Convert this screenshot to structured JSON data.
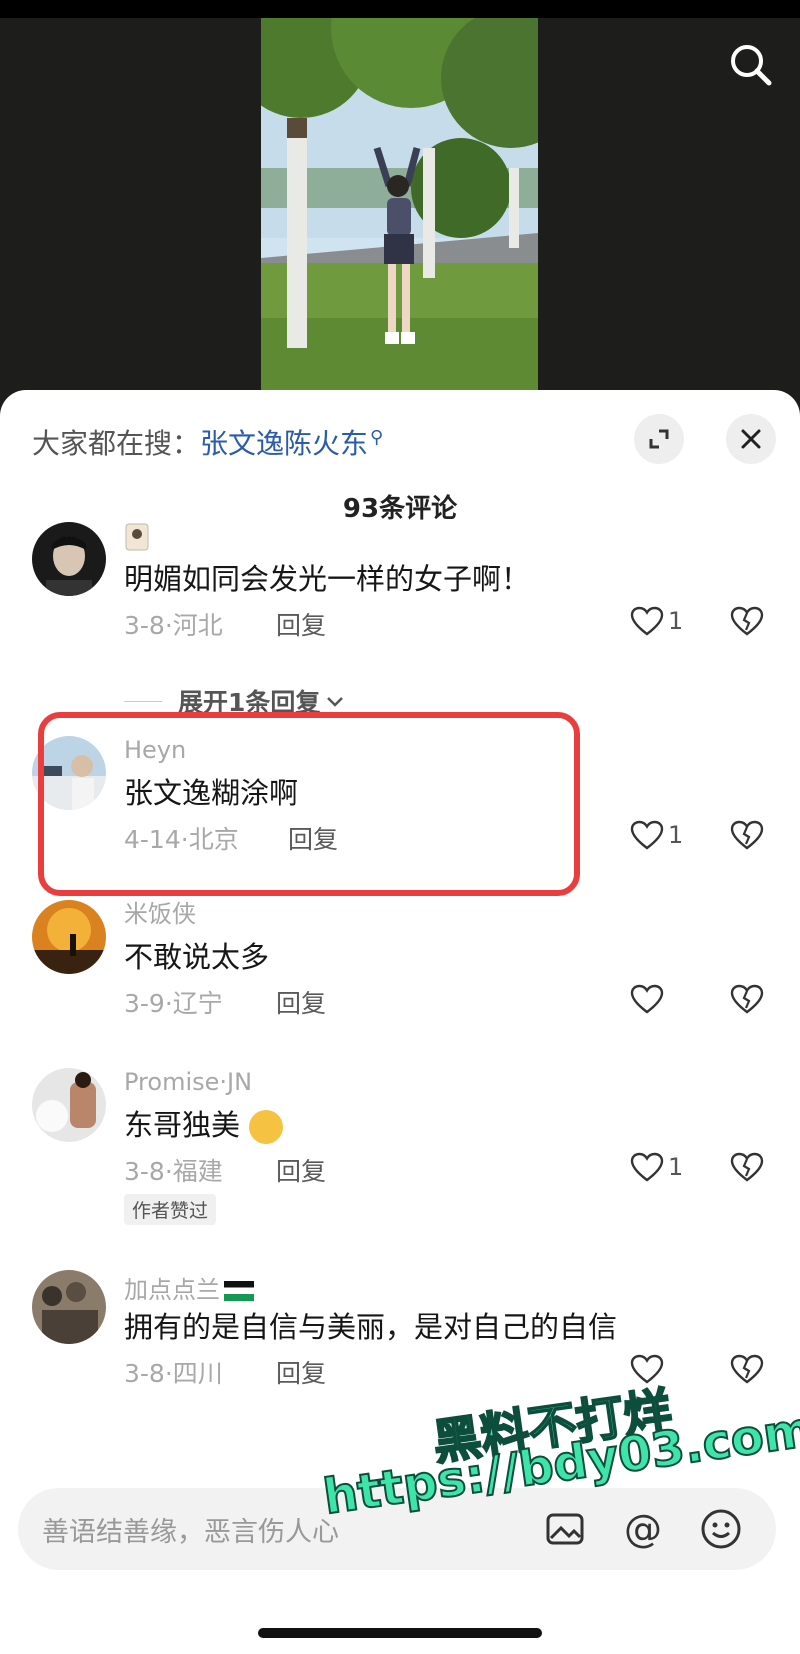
{
  "hot_search": {
    "prefix": "大家都在搜：",
    "query": "张文逸陈火东"
  },
  "comment_count": "93条评论",
  "comments": [
    {
      "name": "",
      "text": "明媚如同会发光一样的女子啊！",
      "date": "3-8",
      "location": "河北",
      "reply": "回复",
      "likes": "1"
    },
    {
      "name": "Heyn",
      "text": "张文逸糊涂啊",
      "date": "4-14",
      "location": "北京",
      "reply": "回复",
      "likes": "1"
    },
    {
      "name": "米饭侠",
      "text": "不敢说太多",
      "date": "3-9",
      "location": "辽宁",
      "reply": "回复",
      "likes": ""
    },
    {
      "name": "Promise·JN",
      "text": "东哥独美",
      "date": "3-8",
      "location": "福建",
      "reply": "回复",
      "likes": "1",
      "badge": "作者赞过"
    },
    {
      "name": "加点点兰",
      "text": "拥有的是自信与美丽，是对自己的自信",
      "date": "3-8",
      "location": "四川",
      "reply": "回复",
      "likes": ""
    }
  ],
  "expand_replies": "展开1条回复",
  "input": {
    "placeholder": "善语结善缘，恶言伤人心"
  },
  "watermark": {
    "line1": "黑料不打烊",
    "line2": "https://bdy03.com"
  },
  "colors": {
    "accent_link": "#2b5ca8",
    "highlight_border": "#ea3d3d",
    "watermark": "#3fe4a8"
  },
  "icons": [
    "search-icon",
    "expand-icon",
    "close-icon",
    "heart-icon",
    "broken-heart-icon",
    "image-icon",
    "at-icon",
    "emoji-icon"
  ]
}
